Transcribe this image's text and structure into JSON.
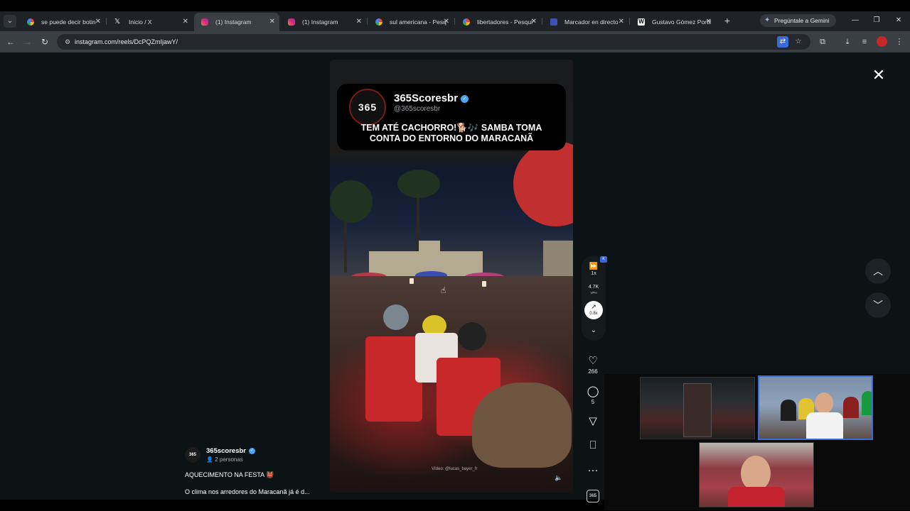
{
  "browser": {
    "tabs": [
      {
        "title": "se puede decir botin",
        "favicon": "google-icon",
        "active": false
      },
      {
        "title": "Inicio / X",
        "favicon": "x-icon",
        "active": false
      },
      {
        "title": "(1) Instagram",
        "favicon": "instagram-icon",
        "active": true
      },
      {
        "title": "(1) Instagram",
        "favicon": "instagram-icon",
        "active": false
      },
      {
        "title": "sul americana - Pesq",
        "favicon": "google-icon",
        "active": false
      },
      {
        "title": "libertadores - Pesqui",
        "favicon": "google-icon",
        "active": false
      },
      {
        "title": "Marcador en directo",
        "favicon": "scoreboard-icon",
        "active": false
      },
      {
        "title": "Gustavo Gómez Portil",
        "favicon": "wikipedia-icon",
        "active": false
      }
    ],
    "gemini_label": "Pregúntale a Gemini",
    "url": "instagram.com/reels/DcPQZmIjawY/"
  },
  "reel": {
    "card": {
      "logo_text": "365",
      "name": "365Scoresbr",
      "handle": "@365scoresbr",
      "headline_line1": "TEM ATÉ CACHORRO!🐕🎶 SAMBA TOMA",
      "headline_line2": "CONTA DO ENTORNO DO MARACANÃ"
    },
    "video_credit": "Vídeo: @lucas_bayer_fr"
  },
  "speed_extension": {
    "speed": "1x",
    "vph_value": "4.7K",
    "vph_label": "VPH",
    "multiplier": "0.8x"
  },
  "actions": {
    "likes": "266",
    "comments": "5"
  },
  "caption": {
    "avatar_text": "365",
    "username": "365scoresbr",
    "collaborators": "2 personas",
    "title": "AQUECIMENTO NA FESTA 👹",
    "description": "O clima nos arredores do Maracanã já é d..."
  },
  "colors": {
    "page_bg": "#0d1215",
    "accent_blue": "#4ba3f6",
    "flamengo_red": "#c8282a"
  }
}
